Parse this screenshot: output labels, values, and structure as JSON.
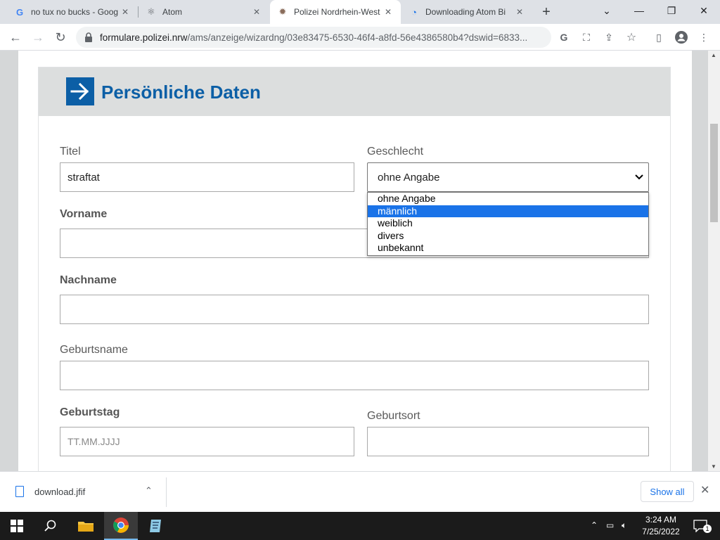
{
  "browser": {
    "tabs": [
      {
        "title": "no tux no bucks - Goog",
        "icon": "google-g-icon"
      },
      {
        "title": "Atom",
        "icon": "atom-icon"
      },
      {
        "title": "Polizei Nordrhein-West",
        "icon": "police-star-icon"
      },
      {
        "title": "Downloading Atom Bi",
        "icon": "atom-download-icon"
      }
    ],
    "url_host": "formulare.polizei.nrw",
    "url_path": "/ams/anzeige/wizardng/03e83475-6530-46f4-a8fd-56e4386580b4?dswid=6833..."
  },
  "form": {
    "section_title": "Persönliche Daten",
    "titel_label": "Titel",
    "titel_value": "straftat",
    "geschlecht_label": "Geschlecht",
    "geschlecht_value": "ohne Angabe",
    "geschlecht_options": [
      "ohne Angabe",
      "männlich",
      "weiblich",
      "divers",
      "unbekannt"
    ],
    "geschlecht_highlighted": "männlich",
    "vorname_label": "Vorname",
    "nachname_label": "Nachname",
    "geburtsname_label": "Geburtsname",
    "geburtstag_label": "Geburtstag",
    "geburtstag_placeholder": "TT.MM.JJJJ",
    "geburtsort_label": "Geburtsort"
  },
  "downloads": {
    "file_name": "download.jfif",
    "show_all_label": "Show all"
  },
  "taskbar": {
    "time": "3:24 AM",
    "date": "7/25/2022",
    "notification_count": "1"
  },
  "colors": {
    "brand_blue": "#0c5fa6",
    "highlight_blue": "#1a73e8"
  }
}
